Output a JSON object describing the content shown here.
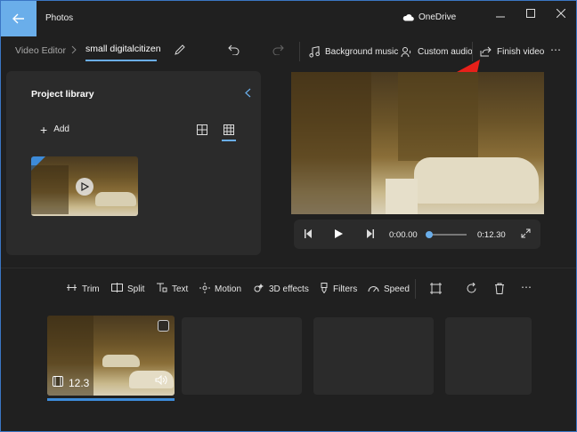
{
  "window": {
    "title": "Photos",
    "onedrive": "OneDrive"
  },
  "toolbar": {
    "breadcrumb_root": "Video Editor",
    "project_name": "small digitalcitizen",
    "background_music": "Background music",
    "custom_audio": "Custom audio",
    "finish_video": "Finish video"
  },
  "library": {
    "title": "Project library",
    "add_label": "Add"
  },
  "player": {
    "current_time": "0:00.00",
    "total_time": "0:12.30",
    "progress": 0.0
  },
  "edit_tools": {
    "trim": "Trim",
    "split": "Split",
    "text": "Text",
    "motion": "Motion",
    "effects_3d": "3D effects",
    "filters": "Filters",
    "speed": "Speed"
  },
  "storyboard": {
    "clip_duration": "12.3"
  },
  "colors": {
    "accent": "#6aaeea",
    "annotation_arrow": "#e8201a",
    "selection_bar": "#3d8bd9"
  }
}
